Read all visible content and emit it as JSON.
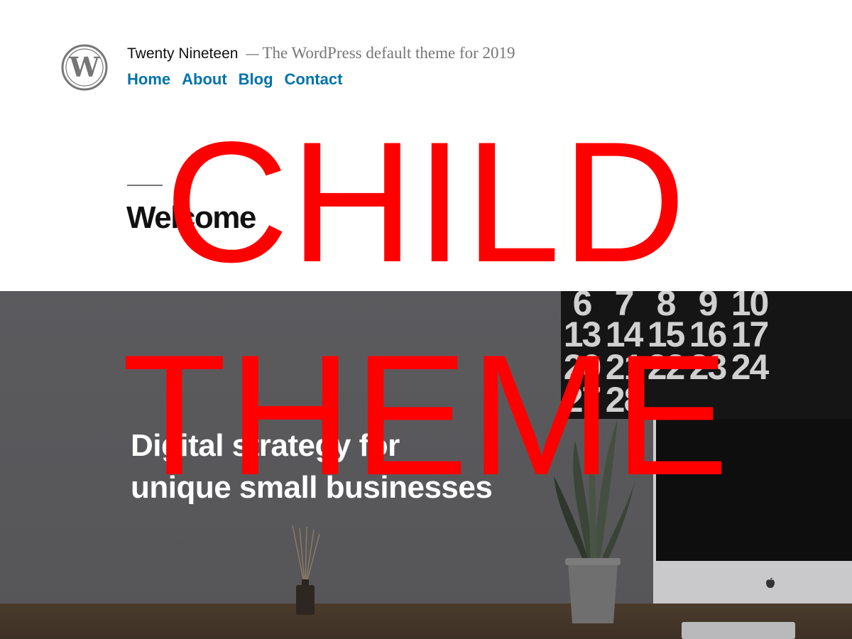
{
  "header": {
    "site_title": "Twenty Nineteen",
    "separator": "—",
    "site_description": "The WordPress default theme for 2019",
    "nav": [
      {
        "label": "Home"
      },
      {
        "label": "About"
      },
      {
        "label": "Blog"
      },
      {
        "label": "Contact"
      }
    ]
  },
  "main": {
    "title": "Welcome"
  },
  "hero": {
    "line1": "Digital strategy for",
    "line2": "unique small businesses",
    "calendar_rows": [
      [
        "6",
        "7",
        "8",
        "9",
        "10"
      ],
      [
        "13",
        "14",
        "15",
        "16",
        "17"
      ],
      [
        "20",
        "21",
        "22",
        "23",
        "24"
      ],
      [
        "27",
        "28"
      ]
    ]
  },
  "overlay": {
    "line1": "CHILD",
    "line2": "THEME",
    "color": "#ff0000"
  },
  "colors": {
    "link": "#0073aa",
    "text": "#111111",
    "muted": "#767676"
  }
}
